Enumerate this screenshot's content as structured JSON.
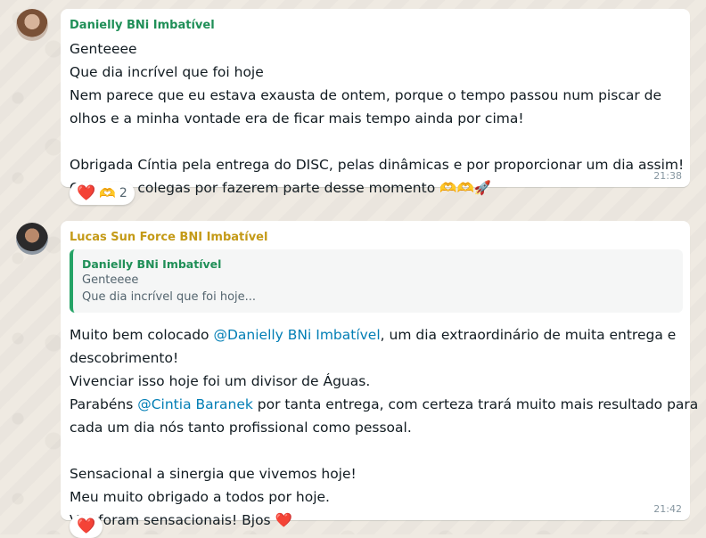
{
  "messages": [
    {
      "sender": "Danielly BNi Imbatível",
      "lines": [
        "Genteeee",
        "Que dia incrível que foi hoje",
        "Nem parece que eu estava exausta de ontem, porque o tempo passou num piscar de",
        "olhos e a minha vontade era de ficar mais tempo ainda por cima!",
        "",
        "Obrigada Cíntia pela entrega do DISC, pelas dinâmicas e por proporcionar um dia assim!",
        "Obrigada colegas por fazerem parte desse momento"
      ],
      "trailing_emoji": "🫶🫶🚀",
      "time": "21:38",
      "reactions": {
        "emojis": [
          "❤️",
          "🫶"
        ],
        "count": "2"
      }
    },
    {
      "sender": "Lucas Sun Force BNI Imbatível",
      "quote": {
        "sender": "Danielly BNi Imbatível",
        "lines": [
          "Genteeee",
          "Que dia incrível que foi hoje..."
        ]
      },
      "line1_prefix": "Muito bem colocado ",
      "mention1": "@Danielly BNi Imbatível",
      "line1_suffix": ", um dia extraordinário de muita entrega e",
      "line2": "descobrimento!",
      "line3": "Vivenciar isso hoje foi um divisor de Águas.",
      "line4_prefix": "Parabéns ",
      "mention2": "@Cintia Baranek",
      "line4_suffix": " por tanta entrega, com certeza trará muito mais resultado para",
      "line5": "cada um dia nós tanto profissional como pessoal.",
      "line6": "Sensacional a sinergia que vivemos hoje!",
      "line7": "Meu muito obrigado a todos por hoje.",
      "line8": "Vcs foram sensacionais! Bjos",
      "line8_emoji": "❤️",
      "time": "21:42",
      "reactions": {
        "emojis": [
          "❤️"
        ]
      }
    }
  ],
  "colors": {
    "background": "#efeae2",
    "sender1": "#1f8f57",
    "sender2": "#c49a17",
    "mention": "#027eb5",
    "quote_bar": "#25a366"
  }
}
